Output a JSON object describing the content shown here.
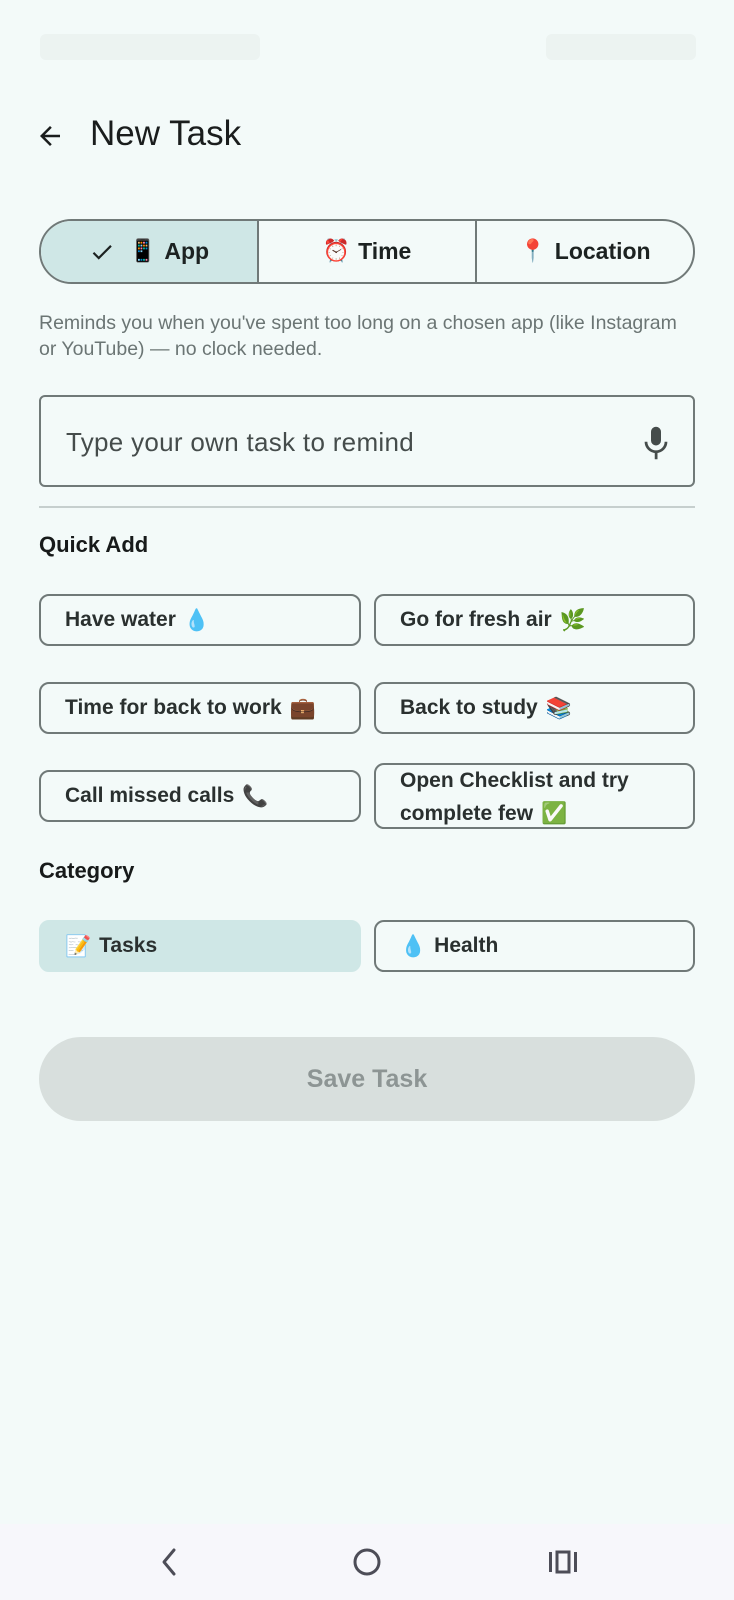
{
  "header": {
    "title": "New Task"
  },
  "trigger_tabs": [
    {
      "label": "App",
      "emoji": "📱",
      "selected": true
    },
    {
      "label": "Time",
      "emoji": "⏰",
      "selected": false
    },
    {
      "label": "Location",
      "emoji": "📍",
      "selected": false
    }
  ],
  "helper_text": "Reminds you when you've spent too long on a chosen app (like Instagram or YouTube) — no clock needed.",
  "task_input": {
    "placeholder": "Type your own task to remind"
  },
  "quick_add": {
    "label": "Quick Add",
    "items": [
      {
        "text": "Have water",
        "emoji": "💧"
      },
      {
        "text": "Go for fresh air",
        "emoji": "🌿"
      },
      {
        "text": "Time for back to work",
        "emoji": "💼"
      },
      {
        "text": "Back to study",
        "emoji": "📚"
      },
      {
        "text": "Call missed calls",
        "emoji": "📞"
      },
      {
        "text": "Open Checklist and try complete few",
        "emoji": "✅"
      }
    ]
  },
  "category": {
    "label": "Category",
    "items": [
      {
        "text": "Tasks",
        "emoji": "📝",
        "selected": true
      },
      {
        "text": "Health",
        "emoji": "💧",
        "selected": false
      }
    ]
  },
  "save_button": {
    "label": "Save Task",
    "enabled": false
  },
  "colors": {
    "background": "#f3faf9",
    "selected_fill": "#cfe7e6",
    "outline": "#707978",
    "disabled_button": "#d8dfdd"
  },
  "icons": [
    "back-arrow-icon",
    "check-icon",
    "mic-icon",
    "nav-back-icon",
    "nav-home-icon",
    "nav-recents-icon"
  ]
}
